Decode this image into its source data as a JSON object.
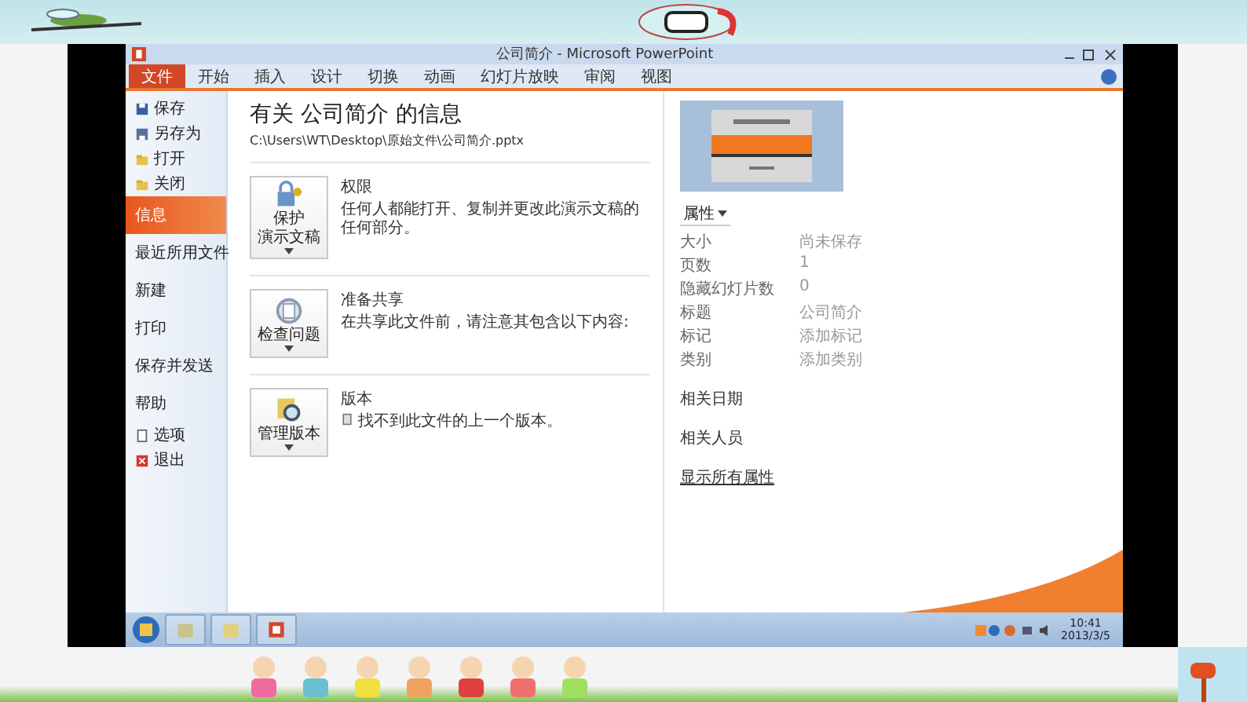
{
  "window": {
    "title": "公司简介 - Microsoft PowerPoint"
  },
  "ribbon_tabs": [
    {
      "label": "文件",
      "selected": true
    },
    {
      "label": "开始",
      "selected": false
    },
    {
      "label": "插入",
      "selected": false
    },
    {
      "label": "设计",
      "selected": false
    },
    {
      "label": "切换",
      "selected": false
    },
    {
      "label": "动画",
      "selected": false
    },
    {
      "label": "幻灯片放映",
      "selected": false
    },
    {
      "label": "审阅",
      "selected": false
    },
    {
      "label": "视图",
      "selected": false
    }
  ],
  "backstage_menu": [
    {
      "label": "保存",
      "kind": "command",
      "selected": false
    },
    {
      "label": "另存为",
      "kind": "command",
      "selected": false
    },
    {
      "label": "打开",
      "kind": "command",
      "selected": false
    },
    {
      "label": "关闭",
      "kind": "command",
      "selected": false
    },
    {
      "label": "信息",
      "kind": "page",
      "selected": true
    },
    {
      "label": "最近所用文件",
      "kind": "page",
      "selected": false
    },
    {
      "label": "新建",
      "kind": "page",
      "selected": false
    },
    {
      "label": "打印",
      "kind": "page",
      "selected": false
    },
    {
      "label": "保存并发送",
      "kind": "page",
      "selected": false
    },
    {
      "label": "帮助",
      "kind": "page",
      "selected": false
    },
    {
      "label": "选项",
      "kind": "command",
      "selected": false
    },
    {
      "label": "退出",
      "kind": "command",
      "selected": false
    }
  ],
  "info": {
    "title": "有关 公司简介 的信息",
    "path": "C:\\Users\\WT\\Desktop\\原始文件\\公司简介.pptx",
    "sections": [
      {
        "button_lines": [
          "保护",
          "演示文稿"
        ],
        "heading": "权限",
        "description": "任何人都能打开、复制并更改此演示文稿的任何部分。"
      },
      {
        "button_lines": [
          "检查问题"
        ],
        "heading": "准备共享",
        "description": "在共享此文件前，请注意其包含以下内容:"
      },
      {
        "button_lines": [
          "管理版本"
        ],
        "heading": "版本",
        "description": "找不到此文件的上一个版本。"
      }
    ]
  },
  "properties": {
    "header": "属性",
    "rows": [
      {
        "label": "大小",
        "value": "尚未保存"
      },
      {
        "label": "页数",
        "value": "1"
      },
      {
        "label": "隐藏幻灯片数",
        "value": "0"
      },
      {
        "label": "标题",
        "value": "公司简介"
      },
      {
        "label": "标记",
        "value": "添加标记"
      },
      {
        "label": "类别",
        "value": "添加类别"
      }
    ],
    "related_dates": "相关日期",
    "related_people": "相关人员",
    "show_all": "显示所有属性"
  },
  "taskbar": {
    "time": "10:41",
    "date": "2013/3/5"
  }
}
